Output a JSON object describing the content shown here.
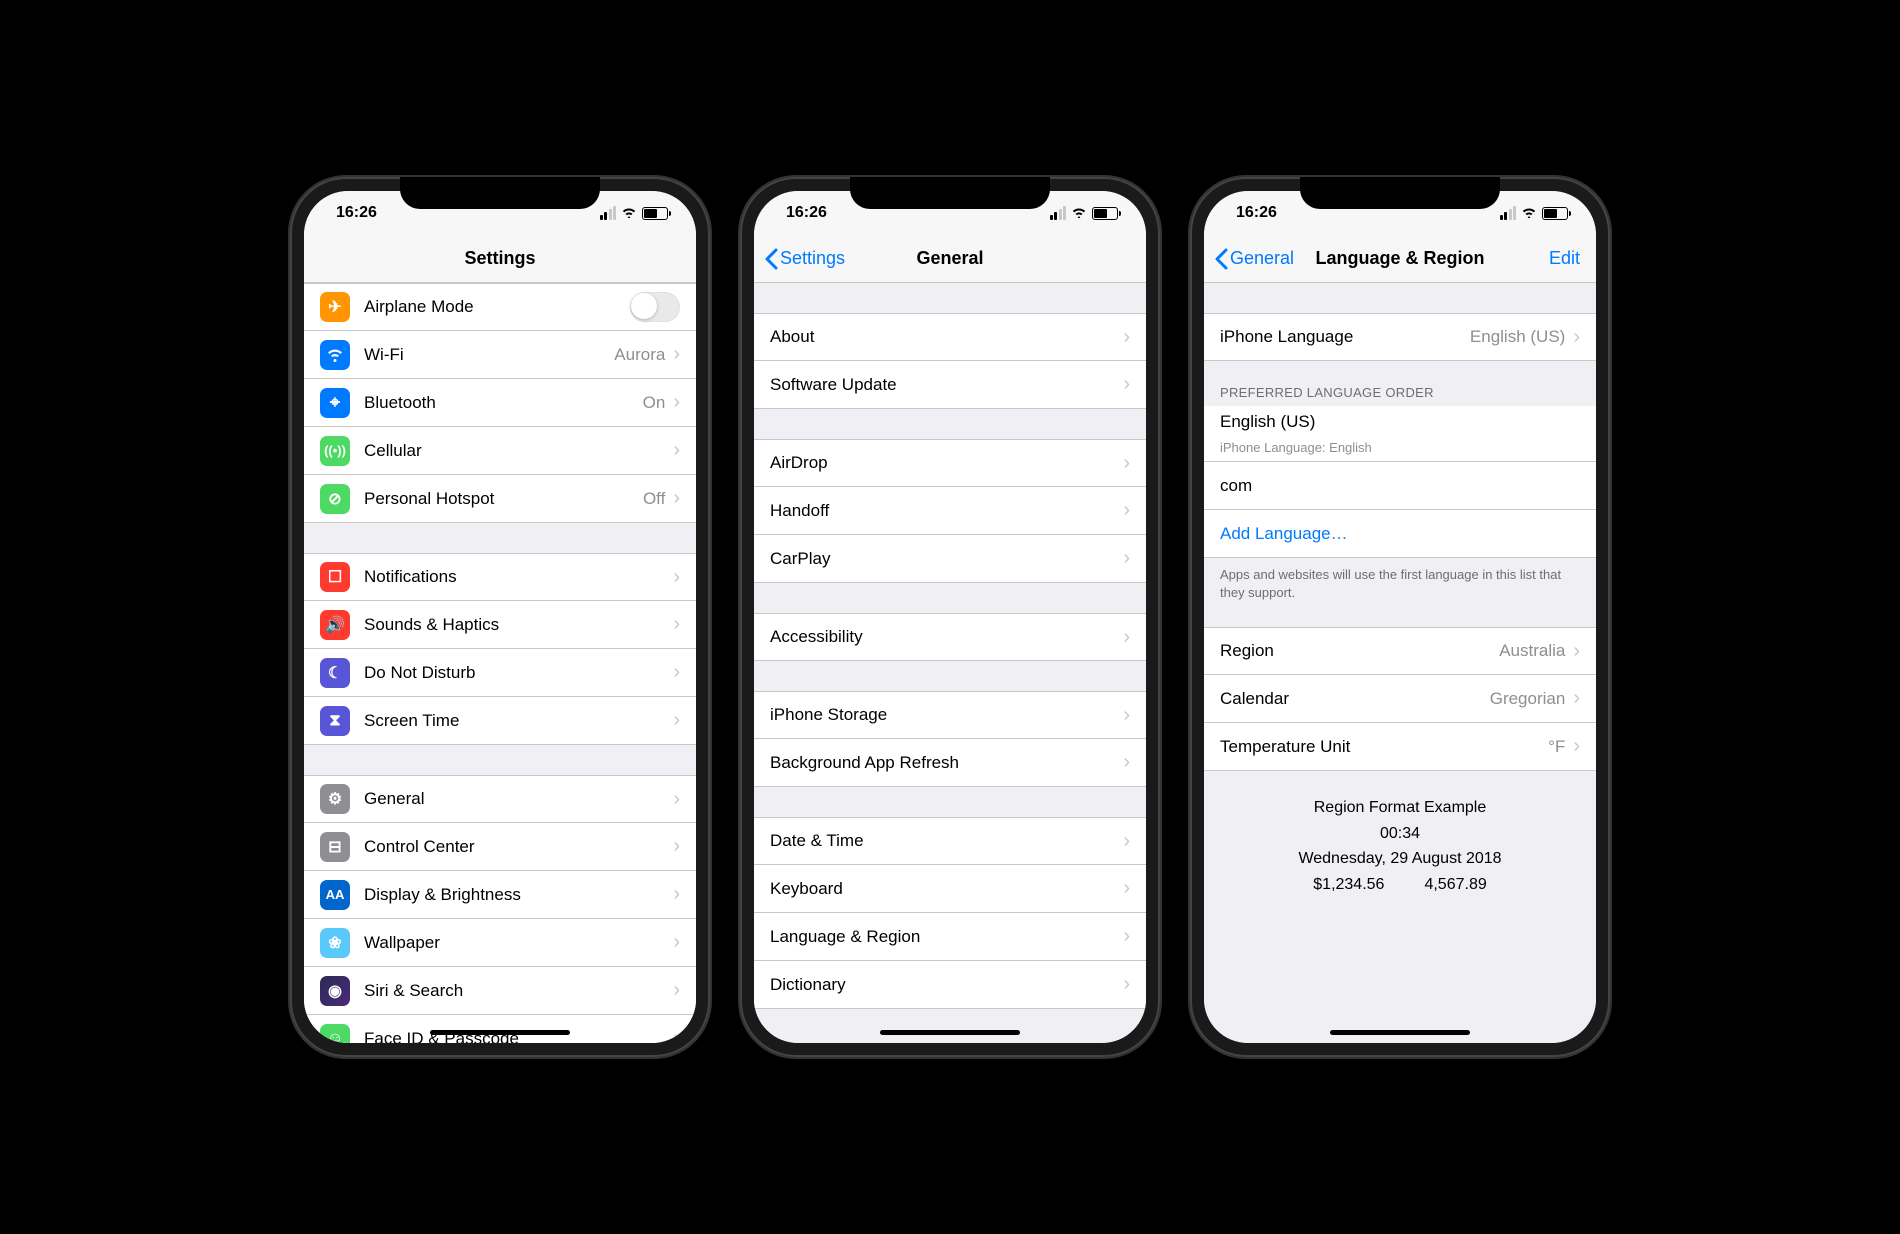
{
  "status": {
    "time": "16:26"
  },
  "screen1": {
    "title": "Settings",
    "items": {
      "airplane": "Airplane Mode",
      "wifi": "Wi-Fi",
      "wifi_value": "Aurora",
      "bluetooth": "Bluetooth",
      "bluetooth_value": "On",
      "cellular": "Cellular",
      "hotspot": "Personal Hotspot",
      "hotspot_value": "Off",
      "notifications": "Notifications",
      "sounds": "Sounds & Haptics",
      "dnd": "Do Not Disturb",
      "screentime": "Screen Time",
      "general": "General",
      "controlcenter": "Control Center",
      "display": "Display & Brightness",
      "wallpaper": "Wallpaper",
      "siri": "Siri & Search",
      "faceid": "Face ID & Passcode"
    }
  },
  "screen2": {
    "back": "Settings",
    "title": "General",
    "items": {
      "about": "About",
      "software": "Software Update",
      "airdrop": "AirDrop",
      "handoff": "Handoff",
      "carplay": "CarPlay",
      "accessibility": "Accessibility",
      "storage": "iPhone Storage",
      "refresh": "Background App Refresh",
      "datetime": "Date & Time",
      "keyboard": "Keyboard",
      "language": "Language & Region",
      "dictionary": "Dictionary"
    }
  },
  "screen3": {
    "back": "General",
    "title": "Language & Region",
    "edit": "Edit",
    "iphone_language_label": "iPhone Language",
    "iphone_language_value": "English (US)",
    "preferred_header": "PREFERRED LANGUAGE ORDER",
    "lang1": "English (US)",
    "lang1_sub": "iPhone Language: English",
    "lang2": "com",
    "add_language": "Add Language…",
    "preferred_footer": "Apps and websites will use the first language in this list that they support.",
    "region_label": "Region",
    "region_value": "Australia",
    "calendar_label": "Calendar",
    "calendar_value": "Gregorian",
    "temp_label": "Temperature Unit",
    "temp_value": "°F",
    "example_title": "Region Format Example",
    "example_time": "00:34",
    "example_date": "Wednesday, 29 August 2018",
    "example_num1": "$1,234.56",
    "example_num2": "4,567.89"
  }
}
